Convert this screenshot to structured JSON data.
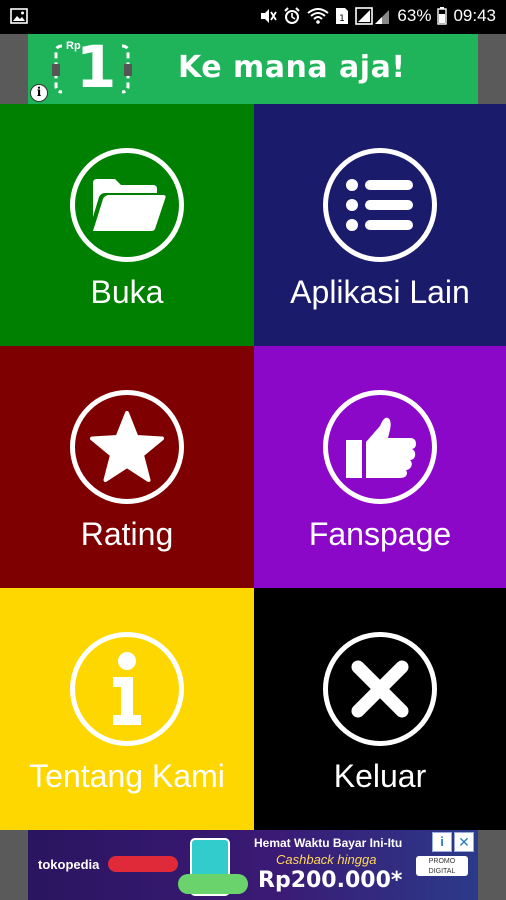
{
  "status_bar": {
    "battery_percent": "63%",
    "time": "09:43",
    "icons": [
      "image-notification-icon",
      "mute-icon",
      "alarm-icon",
      "wifi-icon",
      "sim-icon",
      "signal-icon",
      "battery-icon"
    ]
  },
  "top_ad": {
    "badge_currency": "Rp",
    "badge_number": "1",
    "text": "Ke mana aja!",
    "info_label": "i",
    "background": "#1fb45a"
  },
  "menu": {
    "tiles": [
      {
        "label": "Buka",
        "icon": "folder-icon",
        "color": "#008000"
      },
      {
        "label": "Aplikasi Lain",
        "icon": "list-icon",
        "color": "#1a1b6b"
      },
      {
        "label": "Rating",
        "icon": "star-icon",
        "color": "#7f0000"
      },
      {
        "label": "Fanspage",
        "icon": "thumbs-up-icon",
        "color": "#8c08c8"
      },
      {
        "label": "Tentang Kami",
        "icon": "info-icon",
        "color": "#ffd700"
      },
      {
        "label": "Keluar",
        "icon": "close-icon",
        "color": "#000000"
      }
    ]
  },
  "bottom_ad": {
    "brand": "tokopedia",
    "headline": "Hemat Waktu Bayar Ini-Itu",
    "subline": "Cashback hingga",
    "amount": "Rp200.000*",
    "partner": "PROMO DIGITAL",
    "info_label": "i",
    "close_label": "✕"
  }
}
